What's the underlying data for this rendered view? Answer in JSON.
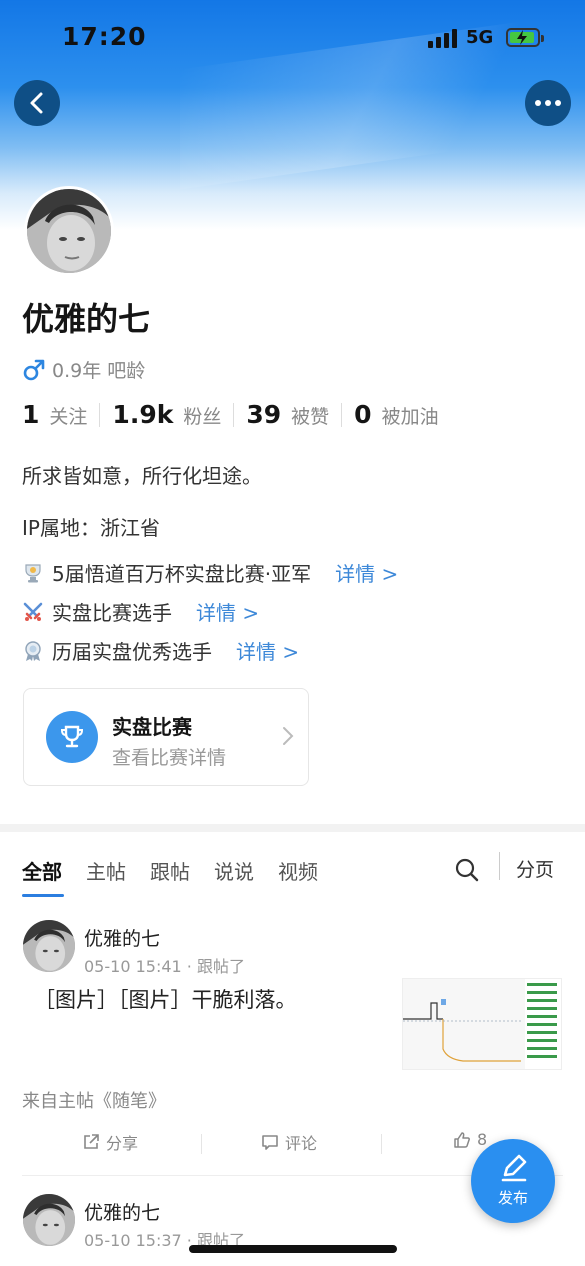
{
  "status_bar": {
    "time": "17:20",
    "network": "5G"
  },
  "profile": {
    "name": "优雅的七",
    "bar_age": "0.9年 吧龄",
    "stats": [
      {
        "value": "1",
        "label": "关注"
      },
      {
        "value": "1.9k",
        "label": "粉丝"
      },
      {
        "value": "39",
        "label": "被赞"
      },
      {
        "value": "0",
        "label": "被加油"
      }
    ],
    "bio": "所求皆如意，所行化坦途。",
    "ip": "IP属地：浙江省",
    "honors": [
      {
        "text": "5届悟道百万杯实盘比赛·亚军",
        "detail": "详情 >"
      },
      {
        "text": "实盘比赛选手",
        "detail": "详情 >"
      },
      {
        "text": "历届实盘优秀选手",
        "detail": "详情 >"
      }
    ]
  },
  "match_card": {
    "title": "实盘比赛",
    "subtitle": "查看比赛详情"
  },
  "tabs": [
    "全部",
    "主帖",
    "跟帖",
    "说说",
    "视频"
  ],
  "split_label": "分页",
  "posts": [
    {
      "author": "优雅的七",
      "meta": "05-10 15:41 · 跟帖了",
      "text": "［图片］［图片］干脆利落。",
      "from": "来自主帖《随笔》",
      "actions": {
        "share": "分享",
        "comment": "评论",
        "like": "8"
      }
    },
    {
      "author": "优雅的七",
      "meta": "05-10 15:37 · 跟帖了"
    }
  ],
  "fab_label": "发布",
  "colors": {
    "accent": "#2a8ff0",
    "link": "#3d88d8",
    "header": "#1377e6"
  }
}
